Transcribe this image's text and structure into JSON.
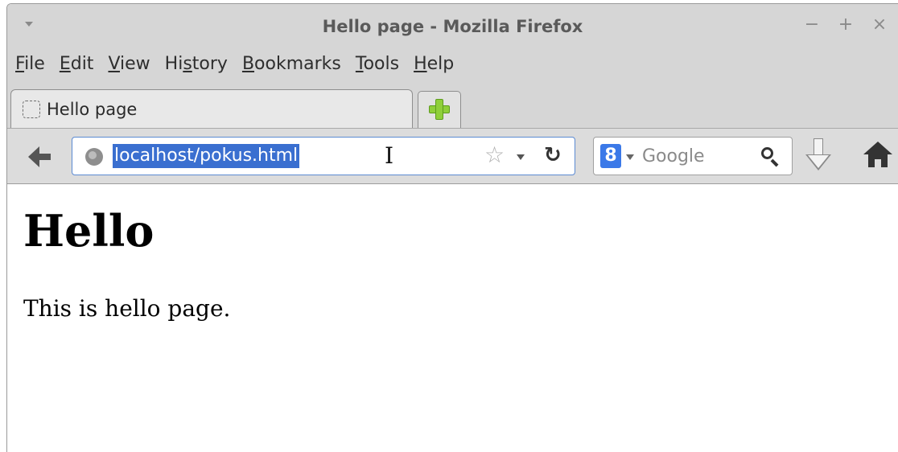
{
  "window": {
    "title": "Hello page - Mozilla Firefox",
    "controls": {
      "minimize": "−",
      "maximize": "+",
      "close": "×"
    }
  },
  "menubar": {
    "items": [
      {
        "label": "File",
        "mnemonic": "F",
        "rest": "ile"
      },
      {
        "label": "Edit",
        "mnemonic": "E",
        "rest": "dit"
      },
      {
        "label": "View",
        "mnemonic": "V",
        "rest": "iew"
      },
      {
        "label": "History",
        "pre": "Hi",
        "mnemonic": "s",
        "rest": "tory"
      },
      {
        "label": "Bookmarks",
        "mnemonic": "B",
        "rest": "ookmarks"
      },
      {
        "label": "Tools",
        "mnemonic": "T",
        "rest": "ools"
      },
      {
        "label": "Help",
        "mnemonic": "H",
        "rest": "elp"
      }
    ]
  },
  "tabs": {
    "active_label": "Hello page"
  },
  "urlbar": {
    "value": "localhost/pokus.html",
    "selected": true
  },
  "search": {
    "engine_letter": "8",
    "placeholder": "Google"
  },
  "icons": {
    "back": "back-arrow-icon",
    "globe": "globe-icon",
    "star": "star-icon",
    "reload": "reload-icon",
    "download": "download-icon",
    "home": "home-icon"
  },
  "page": {
    "heading": "Hello",
    "paragraph": "This is hello page."
  },
  "colors": {
    "selection": "#3a6fd0",
    "chrome": "#d6d6d6",
    "new_tab_plus": "#8fcf3a"
  }
}
